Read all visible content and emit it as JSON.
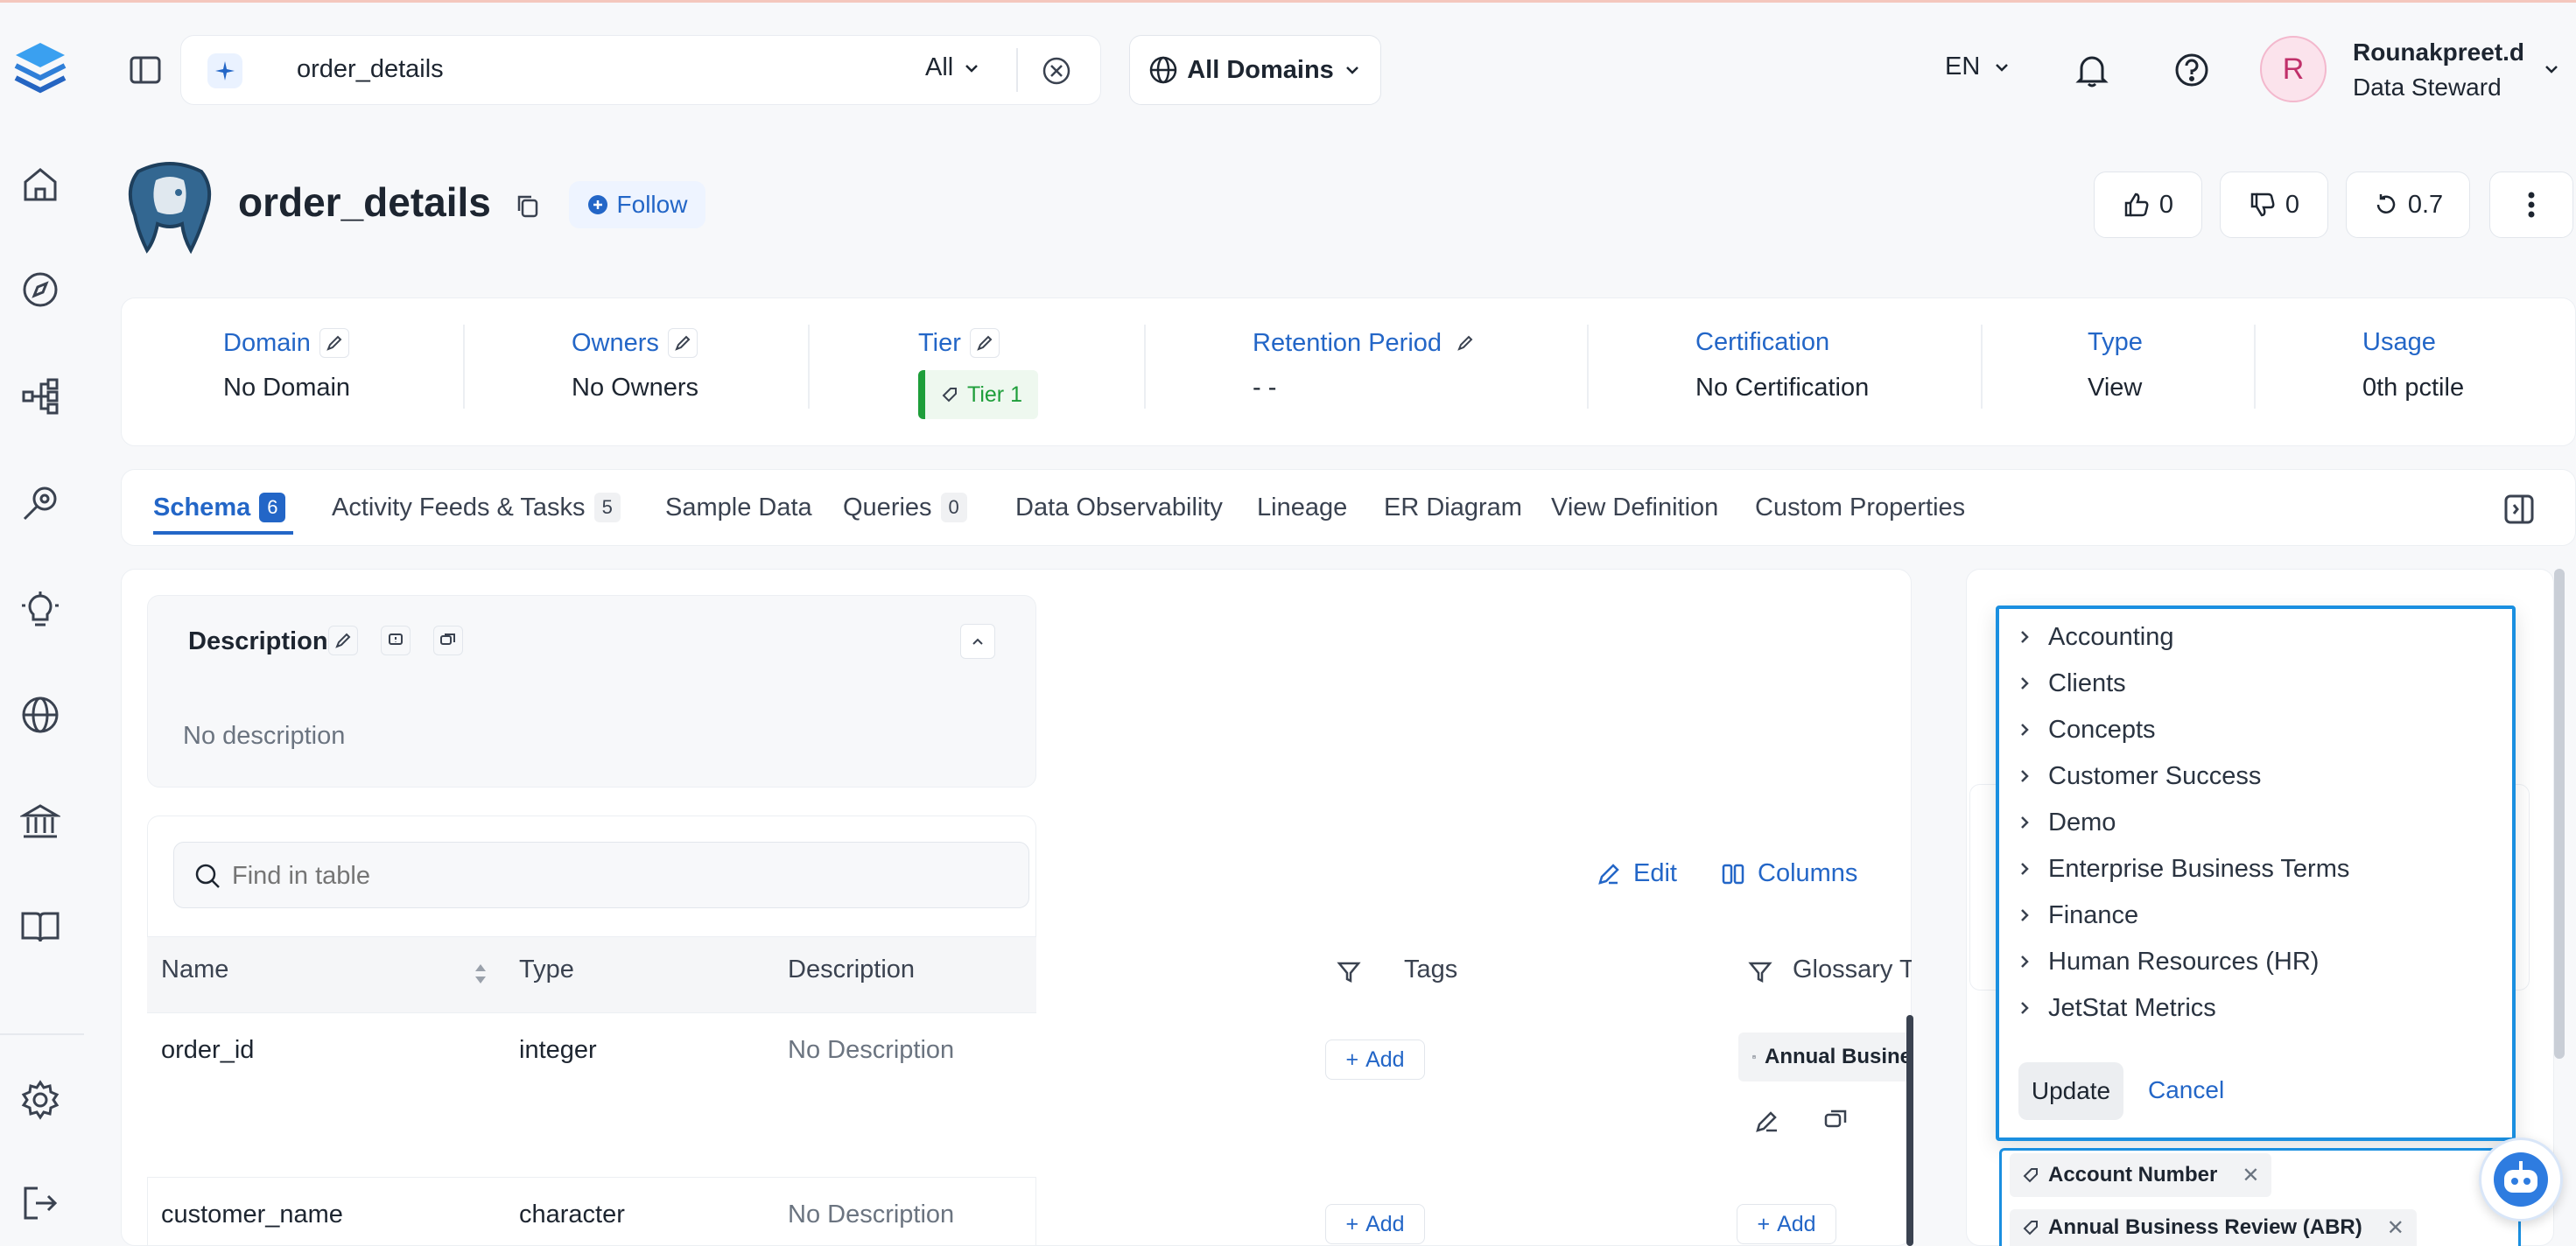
{
  "header": {
    "search_value": "order_details",
    "scope_label": "All",
    "domains_label": "All Domains",
    "lang_label": "EN",
    "user_initial": "R",
    "user_name": "Rounakpreet.d",
    "user_role": "Data Steward"
  },
  "entity": {
    "title": "order_details",
    "follow_label": "Follow",
    "votes_up": "0",
    "votes_down": "0",
    "version": "0.7"
  },
  "info": {
    "domain_label": "Domain",
    "domain_value": "No Domain",
    "owners_label": "Owners",
    "owners_value": "No Owners",
    "tier_label": "Tier",
    "tier_value": "Tier 1",
    "retention_label": "Retention Period",
    "retention_value": "- -",
    "cert_label": "Certification",
    "cert_value": "No Certification",
    "type_label": "Type",
    "type_value": "View",
    "usage_label": "Usage",
    "usage_value": "0th pctile"
  },
  "tabs": [
    {
      "label": "Schema",
      "count": "6"
    },
    {
      "label": "Activity Feeds & Tasks",
      "count": "5"
    },
    {
      "label": "Sample Data"
    },
    {
      "label": "Queries",
      "count": "0"
    },
    {
      "label": "Data Observability"
    },
    {
      "label": "Lineage"
    },
    {
      "label": "ER Diagram"
    },
    {
      "label": "View Definition"
    },
    {
      "label": "Custom Properties"
    }
  ],
  "description": {
    "title": "Description",
    "text": "No description"
  },
  "table": {
    "search_placeholder": "Find in table",
    "edit_label": "Edit",
    "columns_label": "Columns",
    "headers": [
      "Name",
      "Type",
      "Description",
      "Tags",
      "Glossary T"
    ],
    "rows": [
      {
        "name": "order_id",
        "type": "integer",
        "desc": "No Description",
        "tag_add": "Add",
        "glossary": "Annual Busine"
      },
      {
        "name": "customer_name",
        "type": "character",
        "desc": "No Description",
        "tag_add": "Add",
        "glossary_add": "Add"
      }
    ]
  },
  "glossary_dropdown": {
    "items": [
      "Accounting",
      "Clients",
      "Concepts",
      "Customer Success",
      "Demo",
      "Enterprise Business Terms",
      "Finance",
      "Human Resources (HR)",
      "JetStat Metrics"
    ],
    "update_label": "Update",
    "cancel_label": "Cancel",
    "selected": [
      "Account Number",
      "Annual Business Review (ABR)"
    ]
  },
  "colors": {
    "accent": "#2366c7",
    "tier_green": "#1e9e3a",
    "dropdown_border": "#1a8fe0",
    "avatar_bg": "#fbe3ec",
    "avatar_text": "#c0306a"
  }
}
